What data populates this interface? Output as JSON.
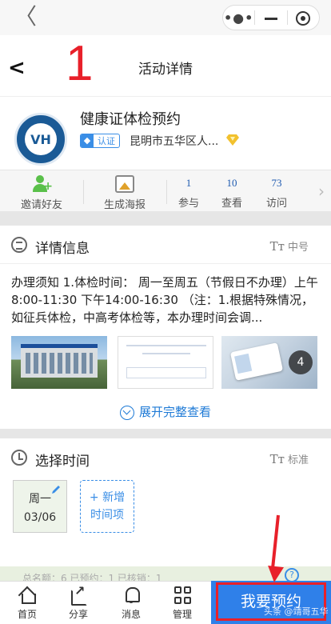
{
  "colors": {
    "accent": "#2f80e9",
    "annotation_red": "#e8202a",
    "link_blue": "#1e7ad6",
    "stat_blue": "#1e5ab0",
    "invite_green": "#5ac04a"
  },
  "topbar": {
    "back_icon": "chevron-left-icon",
    "capsule": [
      "more-dots-icon",
      "minimize-icon",
      "close-ring-icon"
    ]
  },
  "navbar": {
    "step_number": "1",
    "title": "活动详情"
  },
  "header": {
    "org_title": "健康证体检预约",
    "cert_label": "认证",
    "location": "昆明市五华区人...",
    "logo_text": "VH"
  },
  "stats": {
    "invite_label": "邀请好友",
    "poster_label": "生成海报",
    "items": [
      {
        "num": "1",
        "label": "参与"
      },
      {
        "num": "10",
        "label": "查看"
      },
      {
        "num": "73",
        "label": "访问"
      }
    ]
  },
  "detail": {
    "title": "详情信息",
    "font_size_label": "中号",
    "text": "办理须知 1.体检时间： 周一至周五（节假日不办理）上午8:00-11:30 下午14:00-16:30 （注：1.根据特殊情况，如征兵体检，中高考体检等，本办理时间会调...",
    "photo_count": "4",
    "expand_label": "展开完整查看"
  },
  "time": {
    "title": "选择时间",
    "font_size_label": "标准",
    "slot": {
      "day": "周一",
      "date": "03/06"
    },
    "add_line1": "+ 新增",
    "add_line2": "时间项"
  },
  "strip": {
    "text": "总名额：6    已预约：1    已核销：1"
  },
  "tabbar": {
    "home": "首页",
    "share": "分享",
    "message": "消息",
    "manage": "管理",
    "cta": "我要预约"
  },
  "watermark": "头条 @靖哥五华"
}
